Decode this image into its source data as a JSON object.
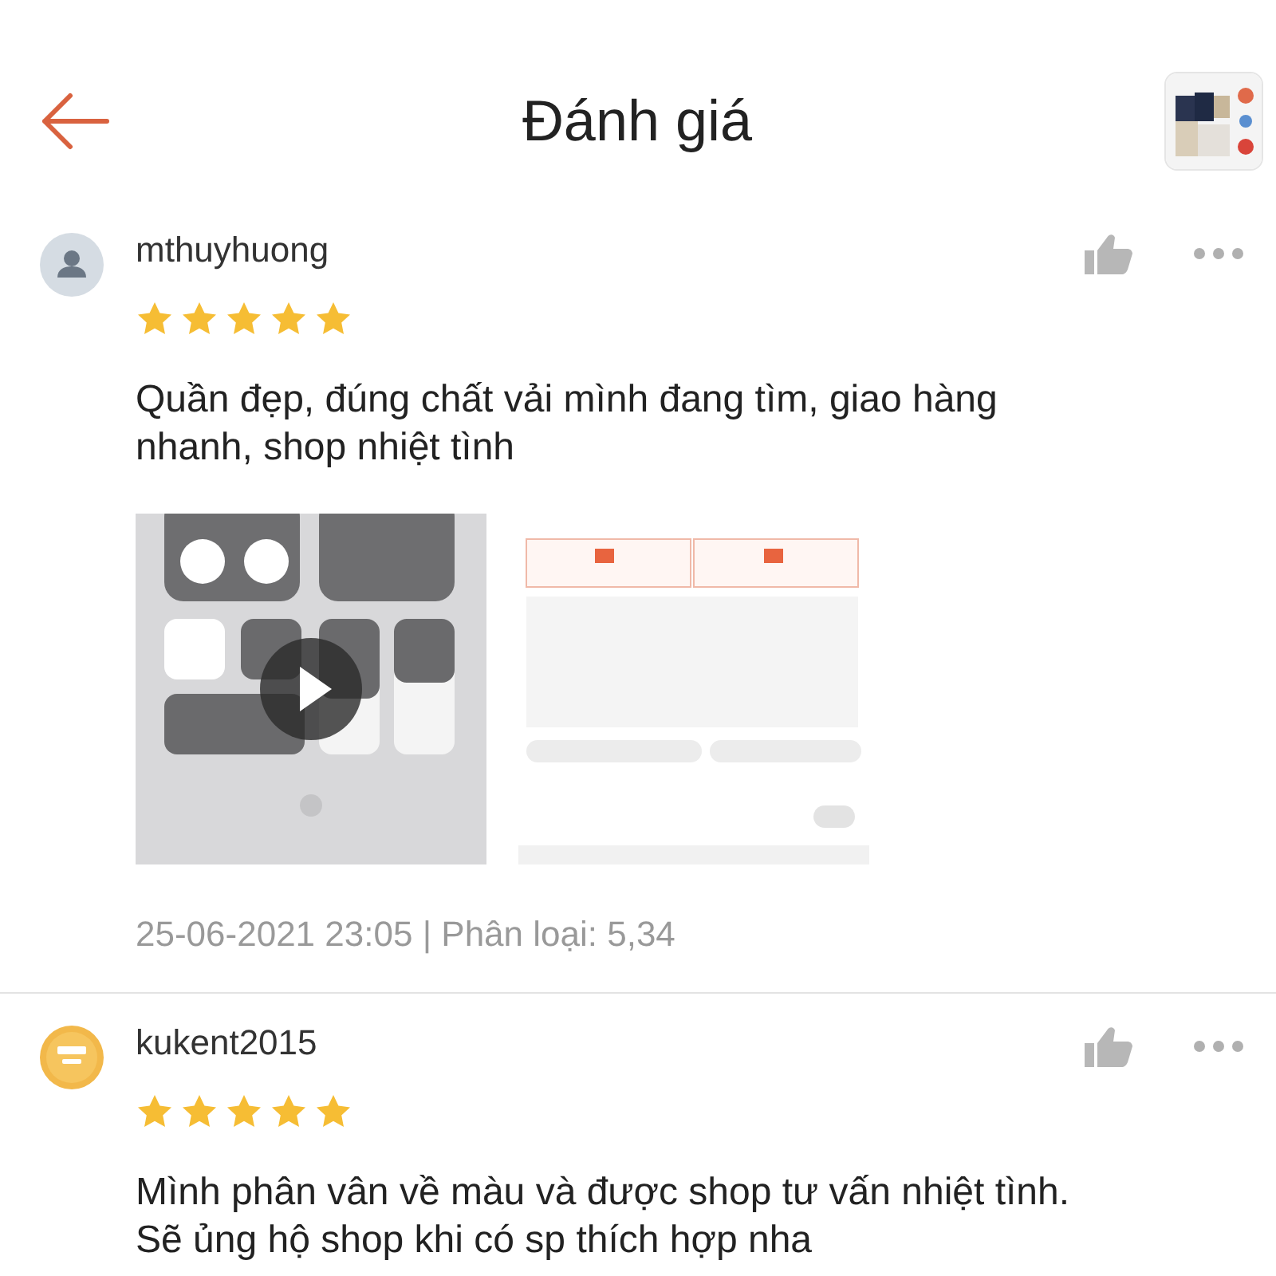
{
  "header": {
    "title": "Đánh giá",
    "product_thumbnail": {
      "kind": "picture"
    }
  },
  "reviews": [
    {
      "username": "mthuyhuong",
      "avatar": {
        "kind": "placeholder"
      },
      "stars": 5,
      "text": "Quần đẹp, đúng chất vải mình đang tìm, giao hàng nhanh, shop nhiệt tình",
      "media": [
        {
          "kind": "video"
        },
        {
          "kind": "picture"
        }
      ],
      "meta": "25-06-2021 23:05 | Phân loại: 5,34"
    },
    {
      "username": "kukent2015",
      "avatar": {
        "kind": "logo"
      },
      "stars": 5,
      "text": "Mình phân vân về màu và được shop tư vấn nhiệt tình. Sẽ ủng hộ shop khi có sp thích hợp nha"
    }
  ]
}
